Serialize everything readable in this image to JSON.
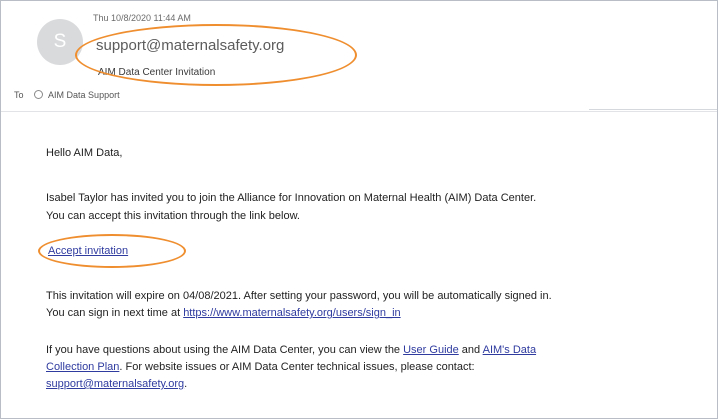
{
  "email": {
    "avatar_initial": "S",
    "date": "Thu 10/8/2020 11:44 AM",
    "sender": "support@maternalsafety.org",
    "subject": "AIM Data Center Invitation",
    "to_label": "To",
    "recipient": "AIM Data Support",
    "highlight_color": "#ef8e2f",
    "link_color": "#2f3b9f"
  },
  "body": {
    "greeting": "Hello AIM Data,",
    "invite_line_1": "Isabel Taylor has invited you to join the Alliance for Innovation on Maternal Health (AIM) Data Center.",
    "invite_line_2": "You can accept this invitation through the link below.",
    "accept_link": "Accept invitation",
    "expire_line": "This invitation will expire on 04/08/2021. After setting your password, you will be automatically signed in.",
    "signin_prefix": "You can sign in next time at ",
    "signin_url": "https://www.maternalsafety.org/users/sign_in",
    "help_prefix": "If you have questions about using the AIM Data Center, you can view the ",
    "user_guide_link": "User Guide",
    "and_text": " and ",
    "data_plan_link_part1": "AIM's Data",
    "data_plan_link_part2": "Collection Plan",
    "website_issues_text": ". For website issues or AIM Data Center technical issues, please contact:",
    "support_email": "support@maternalsafety.org",
    "final_period": "."
  }
}
